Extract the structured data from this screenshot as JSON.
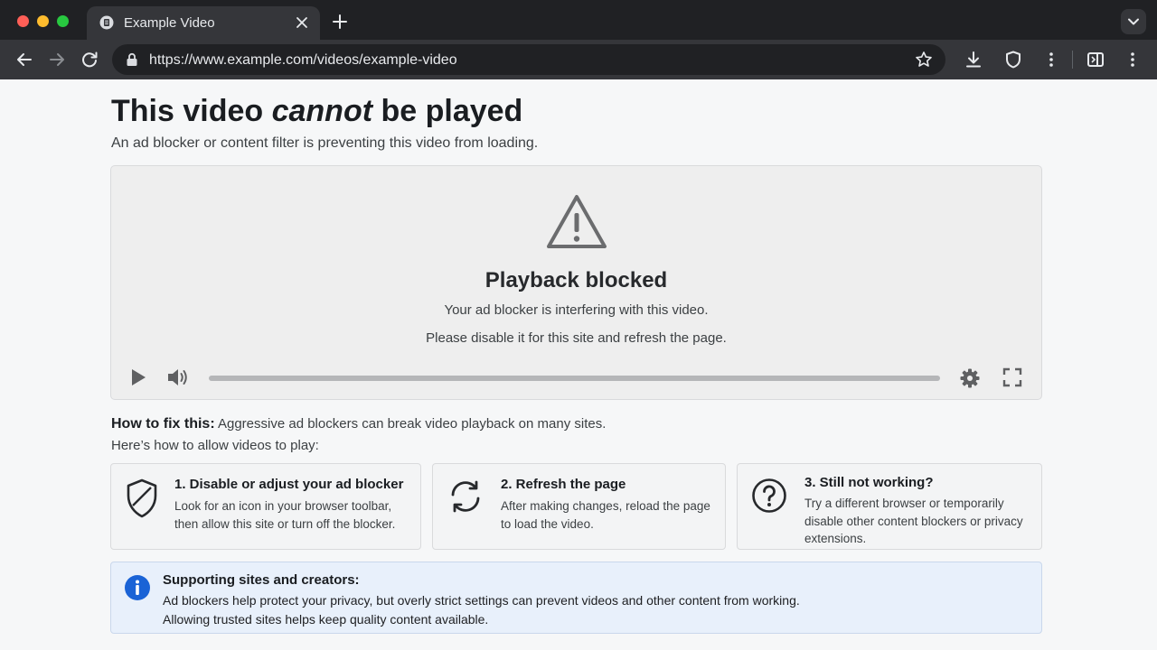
{
  "browser": {
    "tab_title": "Example Video",
    "url": "https://www.example.com/videos/example-video",
    "icons": {
      "tab": "document-icon",
      "close": "close-icon",
      "new_tab": "plus-icon",
      "tab_menu": "chevron-down-icon",
      "back": "back-arrow-icon",
      "forward": "forward-arrow-icon",
      "reload": "reload-icon",
      "lock": "lock-icon",
      "bookmark": "star-icon",
      "download": "download-icon",
      "extension": "shield-icon",
      "menu": "kebab-menu-icon",
      "side_panel": "side-panel-icon"
    },
    "colors": {
      "frame": "#202124",
      "toolbar": "#35363a"
    }
  },
  "page": {
    "title_before": "This video ",
    "title_emphasis": "cannot",
    "title_after": " be played",
    "subtitle": "An ad blocker or content filter is preventing this video from loading."
  },
  "player": {
    "icon": "warning-icon",
    "heading": "Playback blocked",
    "line1": "Your ad blocker is interfering with this video.",
    "line2": "Please disable it for this site and refresh the page.",
    "controls": {
      "play": "play-icon",
      "volume": "volume-icon",
      "settings": "gear-icon",
      "fullscreen": "fullscreen-icon"
    },
    "progress": 0
  },
  "howto": {
    "label": "How to fix this:",
    "text": " Aggressive ad blockers can break video playback on many sites.",
    "text2": "Here’s how to allow videos to play:"
  },
  "steps": [
    {
      "icon": "shield-icon",
      "title": "1. Disable or adjust your ad blocker",
      "text": "Look for an icon in your browser toolbar, then allow this site or turn off the blocker."
    },
    {
      "icon": "refresh-icon",
      "title": "2. Refresh the page",
      "text": "After making changes, reload the page to load the video."
    },
    {
      "icon": "question-icon",
      "title": "3. Still not working?",
      "text": "Try a different browser or temporarily disable other content blockers or privacy extensions."
    }
  ],
  "info": {
    "icon": "info-icon",
    "title": "Supporting sites and creators:",
    "line1": "Ad blockers help protect your privacy, but overly strict settings can prevent videos and other content from working.",
    "line2": "Allowing trusted sites helps keep quality content available.",
    "accent": "#1a63d6"
  }
}
